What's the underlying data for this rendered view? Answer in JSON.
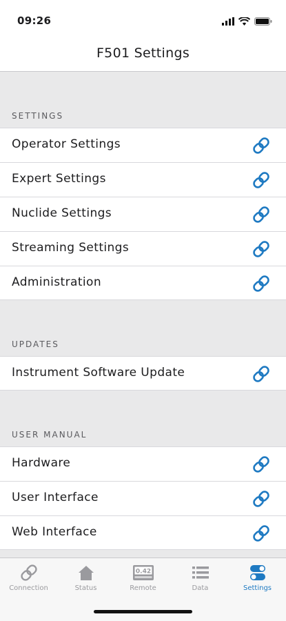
{
  "status_bar": {
    "time": "09:26"
  },
  "nav": {
    "title": "F501 Settings"
  },
  "sections": [
    {
      "header": "SETTINGS",
      "items": [
        "Operator Settings",
        "Expert Settings",
        "Nuclide Settings",
        "Streaming Settings",
        "Administration"
      ]
    },
    {
      "header": "UPDATES",
      "items": [
        "Instrument Software Update"
      ]
    },
    {
      "header": "USER MANUAL",
      "items": [
        "Hardware",
        "User Interface",
        "Web Interface"
      ]
    }
  ],
  "tabs": [
    {
      "label": "Connection",
      "icon": "link-icon"
    },
    {
      "label": "Status",
      "icon": "home-icon"
    },
    {
      "label": "Remote",
      "icon": "display-icon",
      "display_value": "0.42"
    },
    {
      "label": "Data",
      "icon": "list-icon"
    },
    {
      "label": "Settings",
      "icon": "toggle-icon",
      "active": true
    }
  ],
  "colors": {
    "accent": "#1f7ac2",
    "inactive": "#9a9a9e",
    "background": "#e9e9ea"
  }
}
